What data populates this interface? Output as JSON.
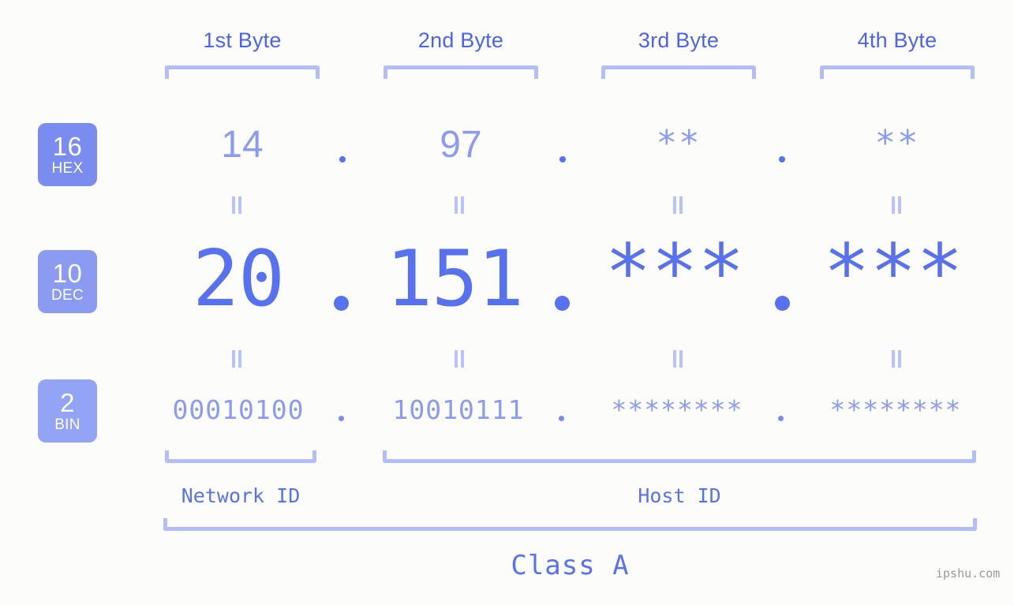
{
  "meta": {
    "background_color": "#fcfdfa",
    "accent_color": "#5871ef",
    "accent_light": "#8c9bf2",
    "bracket_color": "#b3bdf9"
  },
  "byte_headers": [
    {
      "label": "1st Byte"
    },
    {
      "label": "2nd Byte"
    },
    {
      "label": "3rd Byte"
    },
    {
      "label": "4th Byte"
    }
  ],
  "bases": [
    {
      "num": "16",
      "label": "HEX",
      "color": "#7b8cf0"
    },
    {
      "num": "10",
      "label": "DEC",
      "color": "#8c9bf2"
    },
    {
      "num": "2",
      "label": "BIN",
      "color": "#93a3f6"
    }
  ],
  "rows": {
    "hex": {
      "values": [
        "14",
        "97",
        "**",
        "**"
      ]
    },
    "dec": {
      "values": [
        "20",
        "151",
        "***",
        "***"
      ]
    },
    "bin": {
      "values": [
        "00010100",
        "10010111",
        "********",
        "********"
      ]
    }
  },
  "separators": {
    "dot": ".",
    "equals": "="
  },
  "segments": {
    "network_id": "Network ID",
    "host_id": "Host ID",
    "class": "Class A"
  },
  "watermark": "ipshu.com"
}
